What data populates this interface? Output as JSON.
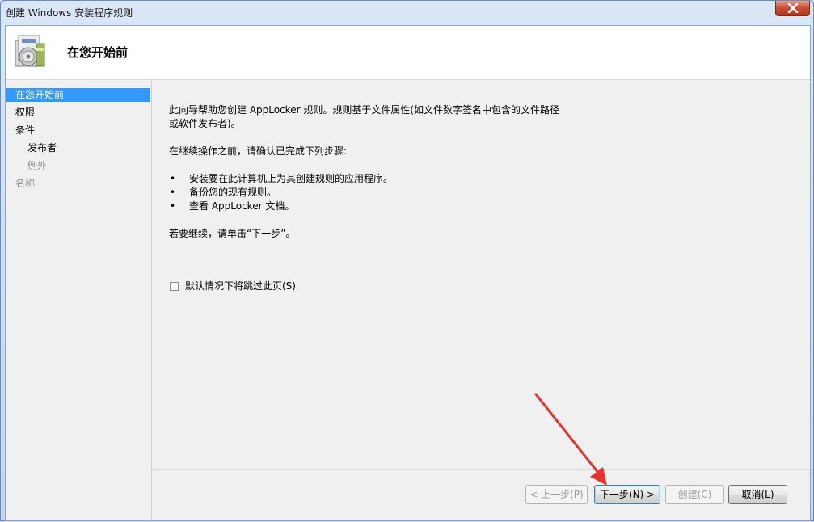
{
  "window": {
    "title": "创建 Windows 安装程序规则"
  },
  "header": {
    "title": "在您开始前",
    "icon": "setup-package-icon"
  },
  "sidebar": {
    "items": [
      {
        "label": "在您开始前",
        "state": "active"
      },
      {
        "label": "权限",
        "state": "normal"
      },
      {
        "label": "条件",
        "state": "normal"
      },
      {
        "label": "发布者",
        "state": "normal"
      },
      {
        "label": "例外",
        "state": "disabled"
      },
      {
        "label": "名称",
        "state": "disabled"
      }
    ]
  },
  "content": {
    "intro_line1": "此向导帮助您创建 AppLocker 规则。规则基于文件属性(如文件数字签名中包含的文件路径",
    "intro_line2": "或软件发布者)。",
    "before_steps": "在继续操作之前，请确认已完成下列步骤:",
    "bullet_char": "•",
    "steps": [
      "安装要在此计算机上为其创建规则的应用程序。",
      "备份您的现有规则。",
      "查看 AppLocker 文档。"
    ],
    "continue_text": "若要继续，请单击“下一步”。",
    "skip_checkbox": {
      "label": "默认情况下将跳过此页(S)",
      "checked": false
    }
  },
  "buttons": {
    "prev": "< 上一步(P)",
    "next": "下一步(N) >",
    "create": "创建(C)",
    "cancel": "取消(L)"
  },
  "colors": {
    "selection": "#3399ff",
    "annotation_arrow": "#e8322a"
  }
}
